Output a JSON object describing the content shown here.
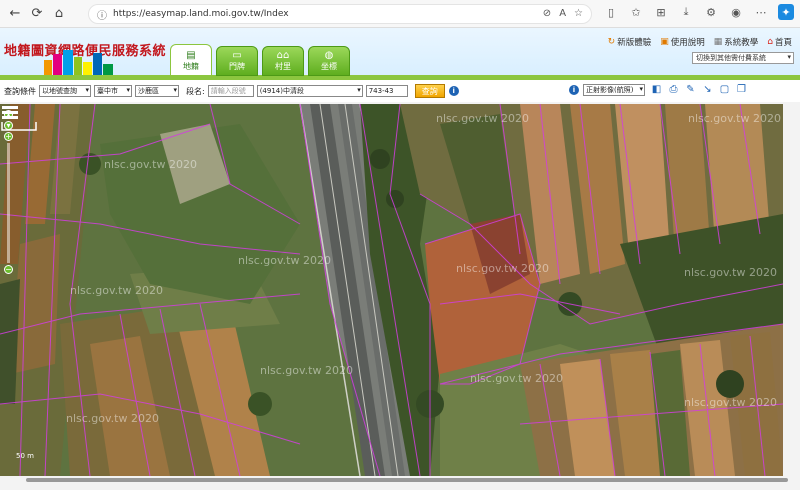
{
  "browser": {
    "url": "https://easymap.land.moi.gov.tw/Index"
  },
  "site": {
    "title": "地籍圖資網路便民服務系統",
    "tabs": [
      {
        "label": "地籍",
        "icon": "map-icon",
        "active": true
      },
      {
        "label": "門牌",
        "icon": "doorplate-icon",
        "active": false
      },
      {
        "label": "村里",
        "icon": "village-icon",
        "active": false
      },
      {
        "label": "坐標",
        "icon": "coordinate-icon",
        "active": false
      }
    ],
    "links": [
      {
        "label": "新版體驗",
        "icon": "refresh-icon"
      },
      {
        "label": "使用說明",
        "icon": "book-icon"
      },
      {
        "label": "系統教學",
        "icon": "tutorial-icon"
      },
      {
        "label": "首頁",
        "icon": "home-icon"
      }
    ],
    "system_select": "切換到其他需付費系統"
  },
  "query": {
    "label": "查詢條件",
    "mode": "以地號查詢",
    "city": "臺中市",
    "district": "沙鹿區",
    "section_label": "段名:",
    "section_placeholder": "請輸入段號",
    "section_value": "(4914)中清段",
    "lot_value": "743-43",
    "button": "查詢",
    "imagery_select": "正射影像(航照)"
  },
  "map": {
    "watermark": "nlsc.gov.tw 2020",
    "scale": "50 m"
  },
  "colors": {
    "accent_green": "#8cc63f",
    "title_red": "#c2161c",
    "parcel_magenta": "#d23ee0",
    "query_orange": "#f0a400"
  }
}
